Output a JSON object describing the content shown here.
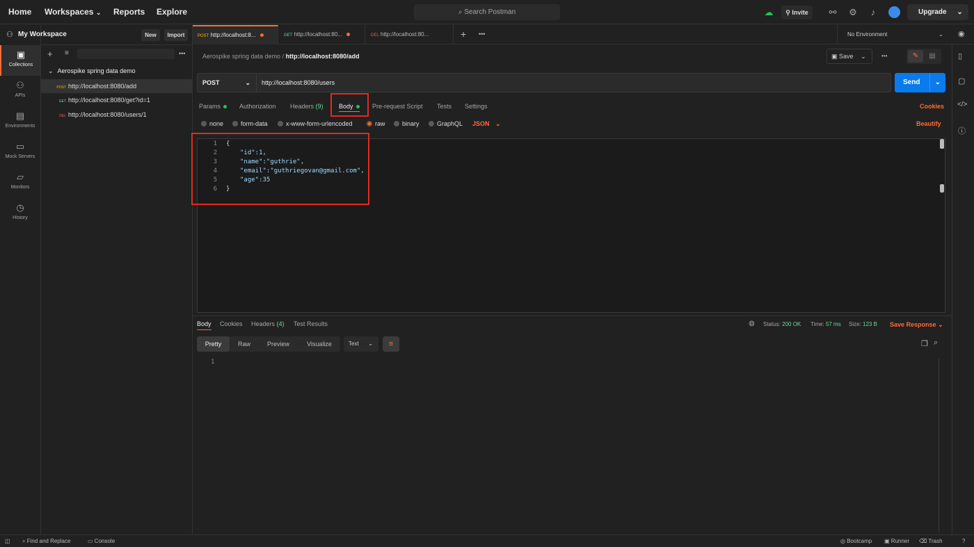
{
  "topnav": {
    "home": "Home",
    "workspaces": "Workspaces",
    "reports": "Reports",
    "explore": "Explore",
    "search_placeholder": "Search Postman",
    "invite": "Invite",
    "upgrade": "Upgrade"
  },
  "rail": [
    {
      "label": "Collections",
      "icon": "collections-icon"
    },
    {
      "label": "APIs",
      "icon": "apis-icon"
    },
    {
      "label": "Environments",
      "icon": "environments-icon"
    },
    {
      "label": "Mock Servers",
      "icon": "mock-servers-icon"
    },
    {
      "label": "Monitors",
      "icon": "monitors-icon"
    },
    {
      "label": "History",
      "icon": "history-icon"
    }
  ],
  "sidebar": {
    "workspace": "My Workspace",
    "new": "New",
    "import": "Import",
    "collection": "Aerospike spring data demo",
    "items": [
      {
        "method": "POST",
        "url": "http://localhost:8080/add"
      },
      {
        "method": "GET",
        "url": "http://localhost:8080/get?id=1"
      },
      {
        "method": "DEL",
        "url": "http://localhost:8080/users/1"
      }
    ]
  },
  "tabs": [
    {
      "method": "POST",
      "label": "http://localhost:8..."
    },
    {
      "method": "GET",
      "label": "http://localhost:80..."
    },
    {
      "method": "DEL",
      "label": "http://localhost:80..."
    }
  ],
  "environment": "No Environment",
  "breadcrumb": {
    "collection": "Aerospike spring data demo",
    "request": "http://localhost:8080/add"
  },
  "save": "Save",
  "request": {
    "method": "POST",
    "url": "http://localhost:8080/users",
    "send": "Send"
  },
  "req_tabs": {
    "params": "Params",
    "authorization": "Authorization",
    "headers": "Headers",
    "headers_count": "(9)",
    "body": "Body",
    "prerequest": "Pre-request Script",
    "tests": "Tests",
    "settings": "Settings",
    "cookies": "Cookies"
  },
  "body_types": {
    "none": "none",
    "form_data": "form-data",
    "urlencoded": "x-www-form-urlencoded",
    "raw": "raw",
    "binary": "binary",
    "graphql": "GraphQL",
    "format": "JSON",
    "beautify": "Beautify"
  },
  "editor": {
    "line_numbers": [
      "1",
      "2",
      "3",
      "4",
      "5",
      "6"
    ],
    "lines": [
      "{",
      "\"id\":1,",
      "\"name\":\"guthrie\",",
      "\"email\":\"guthriegovan@gmail.com\",",
      "\"age\":35",
      "}"
    ]
  },
  "response": {
    "tabs": {
      "body": "Body",
      "cookies": "Cookies",
      "headers": "Headers",
      "headers_count": "(4)",
      "test_results": "Test Results"
    },
    "status_label": "Status:",
    "status": "200 OK",
    "time_label": "Time:",
    "time": "57 ms",
    "size_label": "Size:",
    "size": "123 B",
    "save_response": "Save Response",
    "views": {
      "pretty": "Pretty",
      "raw": "Raw",
      "preview": "Preview",
      "visualize": "Visualize"
    },
    "format": "Text",
    "line": "1"
  },
  "bottom": {
    "find": "Find and Replace",
    "console": "Console",
    "bootcamp": "Bootcamp",
    "runner": "Runner",
    "trash": "Trash"
  },
  "colors": {
    "accent": "#ff6c37",
    "send": "#097bed",
    "highlight": "#e02b20",
    "success": "#6bdd9a"
  }
}
